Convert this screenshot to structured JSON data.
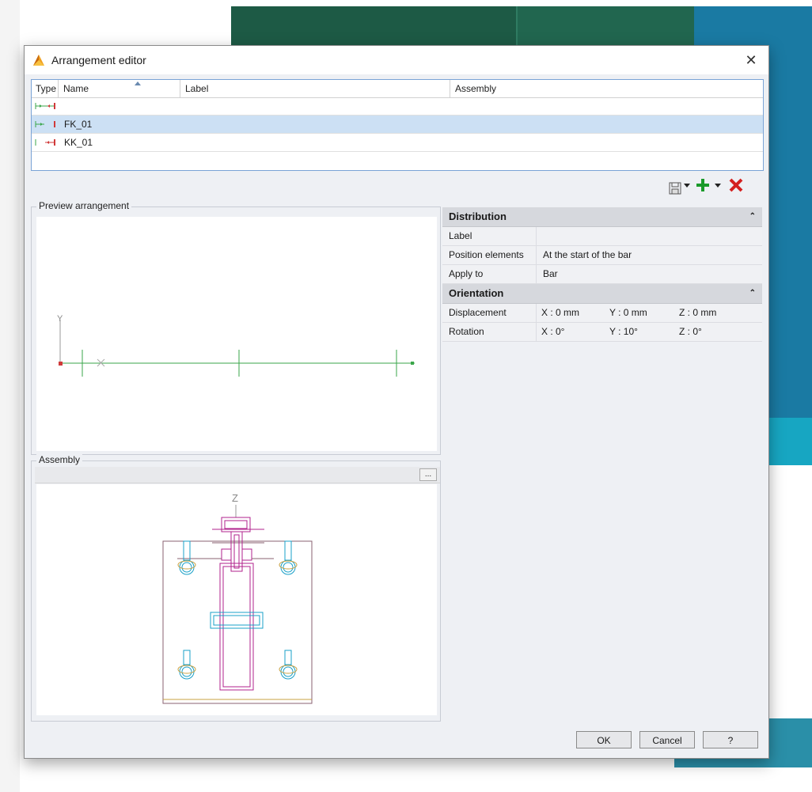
{
  "dialog": {
    "title": "Arrangement editor",
    "close_glyph": "✕"
  },
  "table": {
    "columns": [
      "Type",
      "Name",
      "Label",
      "Assembly"
    ],
    "rows": [
      {
        "type_icon": "arrangement-both-ends-icon",
        "name": "",
        "label": "",
        "assembly": ""
      },
      {
        "type_icon": "arrangement-start-icon",
        "name": "FK_01",
        "label": "",
        "assembly": "",
        "selected": true
      },
      {
        "type_icon": "arrangement-end-icon",
        "name": "KK_01",
        "label": "",
        "assembly": ""
      }
    ]
  },
  "toolbar": {
    "save_icon": "save-icon",
    "add_icon": "add-icon",
    "delete_icon": "delete-icon",
    "add_color": "#1a9a2a",
    "delete_color": "#d4201f"
  },
  "preview": {
    "label": "Preview arrangement",
    "y_axis": "Y"
  },
  "assembly": {
    "label": "Assembly",
    "browse": "...",
    "z_axis": "Z"
  },
  "distribution": {
    "header": "Distribution",
    "rows": [
      {
        "key": "Label",
        "value": ""
      },
      {
        "key": "Position elements",
        "value": "At the start of the bar"
      },
      {
        "key": "Apply to",
        "value": "Bar"
      }
    ]
  },
  "orientation": {
    "header": "Orientation",
    "displacement": {
      "key": "Displacement",
      "x": "X :  0 mm",
      "y": "Y :  0 mm",
      "z": "Z :  0 mm"
    },
    "rotation": {
      "key": "Rotation",
      "x": "X :  0°",
      "y": "Y :  10°",
      "z": "Z :  0°"
    }
  },
  "buttons": {
    "ok": "OK",
    "cancel": "Cancel",
    "help": "?"
  },
  "colors": {
    "selection": "#cce0f4",
    "preview_line": "#3aa64a",
    "assembly_magenta": "#b0228c",
    "assembly_cyan": "#1aa0c8"
  }
}
